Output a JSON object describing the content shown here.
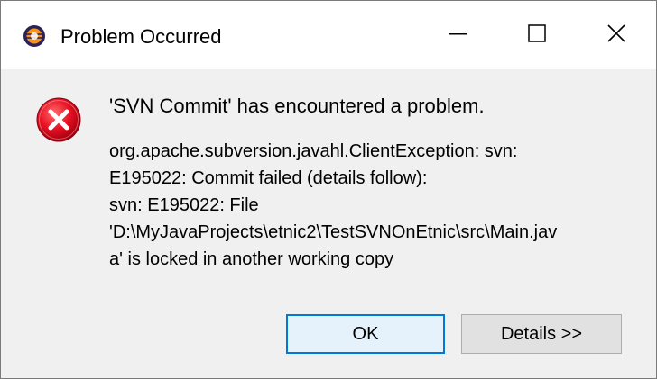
{
  "window": {
    "title": "Problem Occurred",
    "controls": {
      "minimize_icon": "minimize-icon",
      "maximize_icon": "maximize-icon",
      "close_icon": "close-icon"
    }
  },
  "message": {
    "headline": "'SVN Commit' has encountered a problem.",
    "details": [
      "org.apache.subversion.javahl.ClientException: svn:",
      "E195022: Commit failed (details follow):",
      "svn: E195022: File",
      "'D:\\MyJavaProjects\\etnic2\\TestSVNOnEtnic\\src\\Main.jav",
      "a' is locked in another working copy"
    ]
  },
  "buttons": {
    "ok_label": "OK",
    "details_label": "Details >>"
  },
  "colors": {
    "error_red": "#e81123",
    "focus_blue": "#0078d7",
    "dialog_bg": "#f0f0f0",
    "titlebar_bg": "#ffffff"
  }
}
